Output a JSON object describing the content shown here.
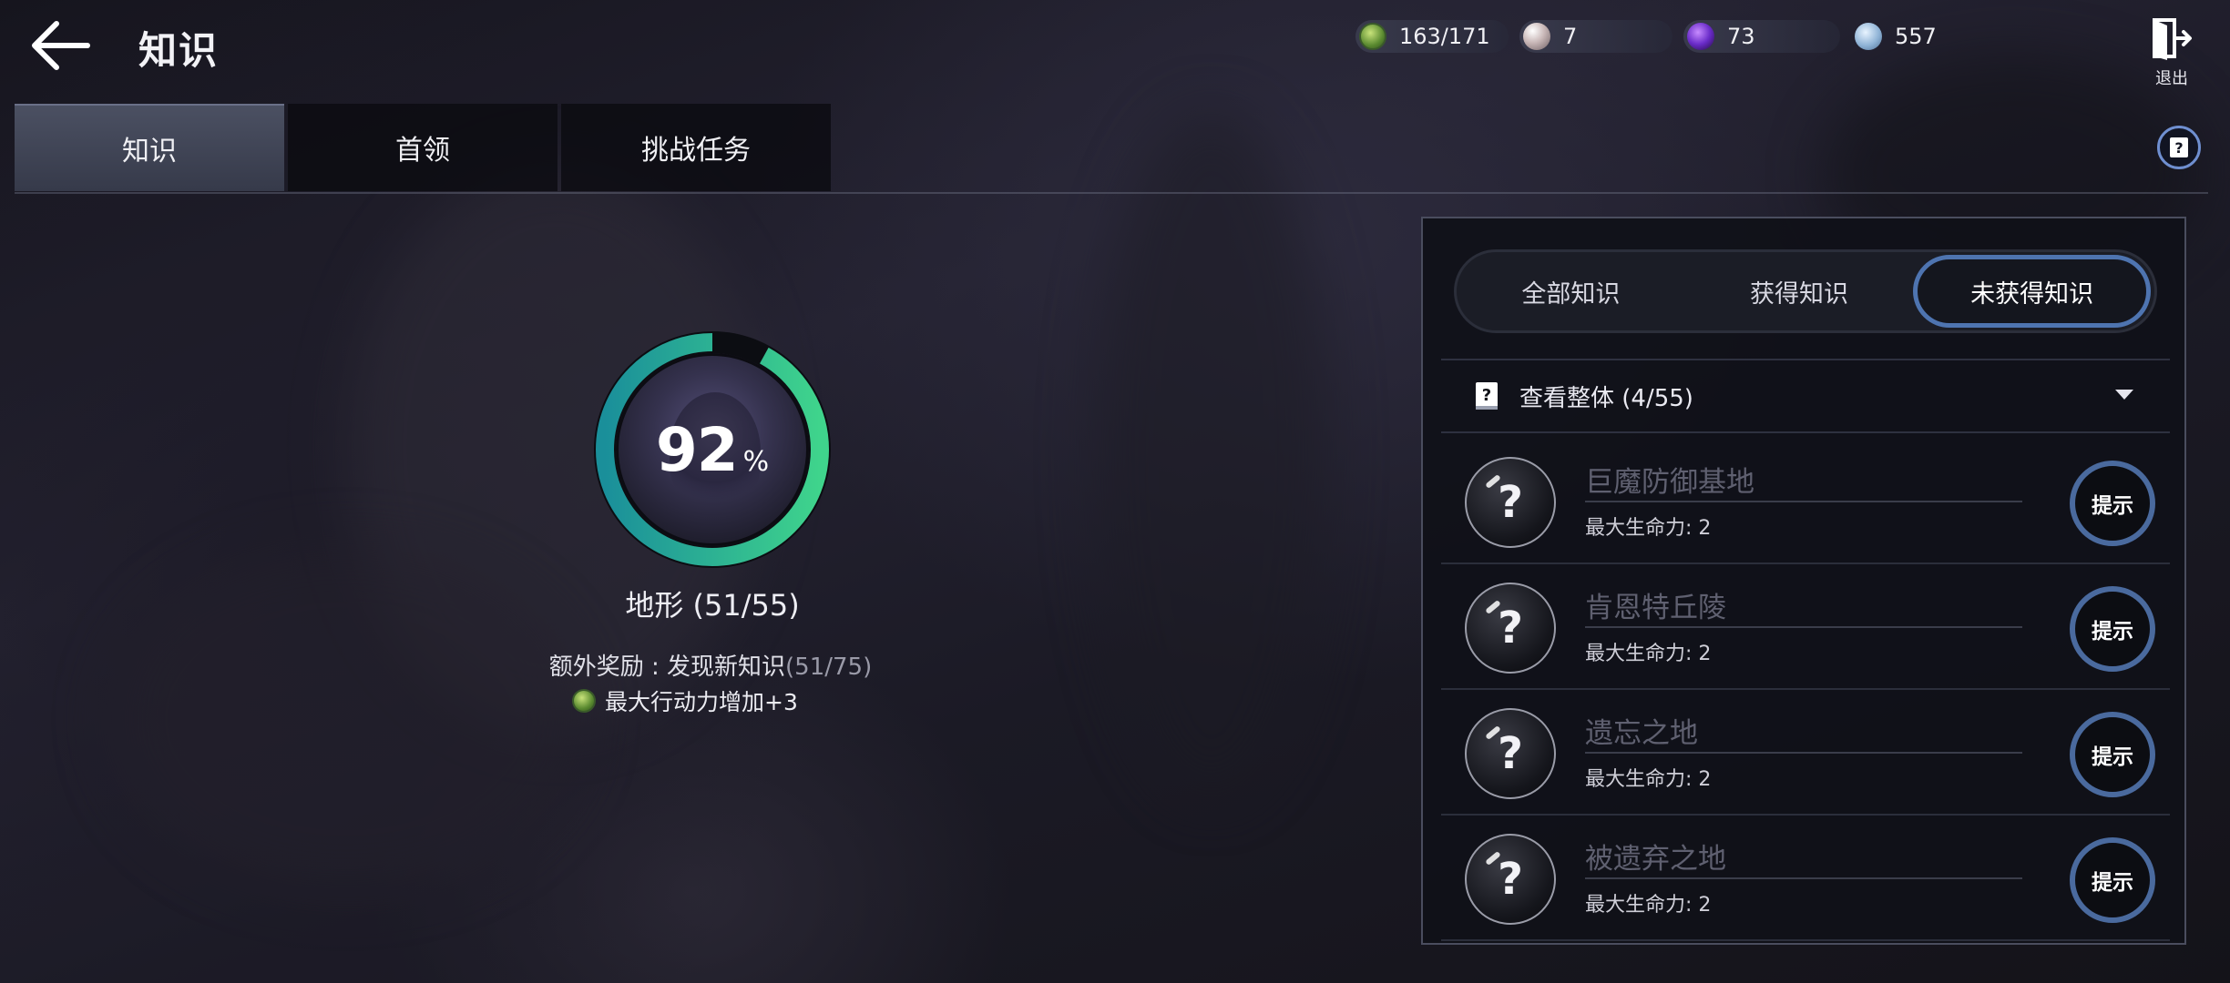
{
  "header": {
    "title": "知识",
    "back_icon": "arrow-left-icon",
    "exit_label": "退出",
    "exit_icon": "exit-door-icon"
  },
  "resources": [
    {
      "icon": "action-point-icon",
      "value": "163/171"
    },
    {
      "icon": "pearl-icon",
      "value": "7"
    },
    {
      "icon": "purple-orb-icon",
      "value": "73"
    },
    {
      "icon": "gem-icon",
      "value": "557"
    }
  ],
  "tabs": [
    {
      "label": "知识",
      "active": true
    },
    {
      "label": "首领",
      "active": false
    },
    {
      "label": "挑战任务",
      "active": false
    }
  ],
  "help_icon": "help-book-icon",
  "progress": {
    "percent": "92",
    "percent_sign": "%",
    "fraction": 0.92,
    "label": "地形 (51/55)",
    "bonus_text": "额外奖励 : 发现新知识",
    "bonus_count": "(51/75)",
    "reward_text": "最大行动力增加+3"
  },
  "filters": [
    {
      "label": "全部知识",
      "active": false
    },
    {
      "label": "获得知识",
      "active": false
    },
    {
      "label": "未获得知识",
      "active": true
    }
  ],
  "overview": {
    "label": "查看整体 (4/55)"
  },
  "items": [
    {
      "name": "巨魔防御基地",
      "stat": "最大生命力: 2",
      "button": "提示"
    },
    {
      "name": "肯恩特丘陵",
      "stat": "最大生命力: 2",
      "button": "提示"
    },
    {
      "name": "遗忘之地",
      "stat": "最大生命力: 2",
      "button": "提示"
    },
    {
      "name": "被遗弃之地",
      "stat": "最大生命力: 2",
      "button": "提示"
    }
  ],
  "colors": {
    "ring_start": "#1a8f8a",
    "ring_end": "#3fcf8a",
    "active_filter_border": "#4e74b0",
    "locked_name": "#5f6070"
  }
}
